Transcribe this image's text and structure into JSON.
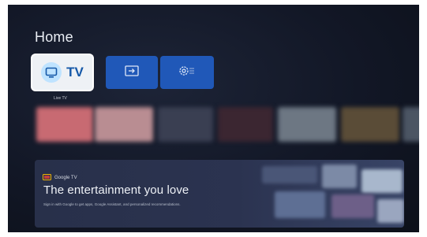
{
  "page": {
    "title": "Home"
  },
  "tiles": {
    "live_tv": {
      "label": "TV",
      "caption": "Live TV"
    },
    "input": {
      "icon": "input-icon"
    },
    "settings": {
      "icon": "settings-icon"
    }
  },
  "banner": {
    "brand": "Google TV",
    "headline": "The entertainment you love",
    "subtext": "Sign in with Google to get apps, Google Assistant, and personalized recommendations."
  },
  "colors": {
    "background": "#121726",
    "tile_blue": "#2058b8",
    "focus_tile": "#eef1f5",
    "tv_accent": "#1558a8"
  }
}
